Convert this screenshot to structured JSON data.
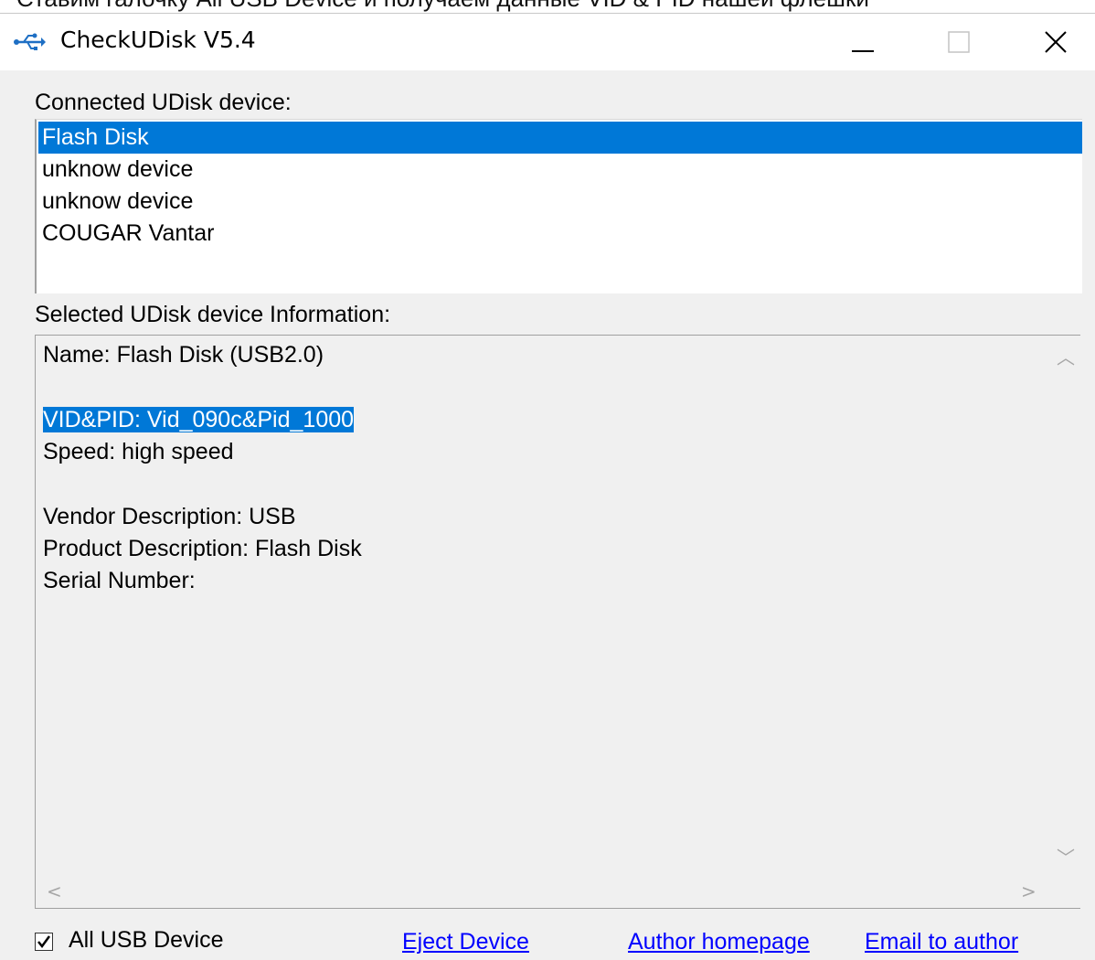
{
  "cropped_caption": "Ставим галочку All USB Device и получаем данные VID & PID нашей флешки",
  "window": {
    "title": "CheckUDisk V5.4",
    "icon": "usb-icon"
  },
  "connected_label": "Connected UDisk device:",
  "devices": [
    {
      "label": "Flash Disk",
      "selected": true
    },
    {
      "label": "unknow device",
      "selected": false
    },
    {
      "label": "unknow device",
      "selected": false
    },
    {
      "label": "COUGAR Vantar",
      "selected": false
    }
  ],
  "info_label": "Selected UDisk device Information:",
  "info": {
    "name": "Name: Flash Disk  (USB2.0)",
    "vid_pid": "VID&PID: Vid_090c&Pid_1000",
    "speed": "Speed: high speed",
    "vendor": "Vendor Description: USB",
    "product": "Product Description: Flash Disk",
    "serial": "Serial Number:"
  },
  "footer": {
    "checkbox_label": "All USB Device",
    "checkbox_checked": true,
    "eject_link": "Eject Device",
    "homepage_link": "Author homepage",
    "email_link": "Email to author"
  },
  "colors": {
    "selection": "#0078d7",
    "link": "#0000ff",
    "window_bg": "#f0f0f0"
  }
}
